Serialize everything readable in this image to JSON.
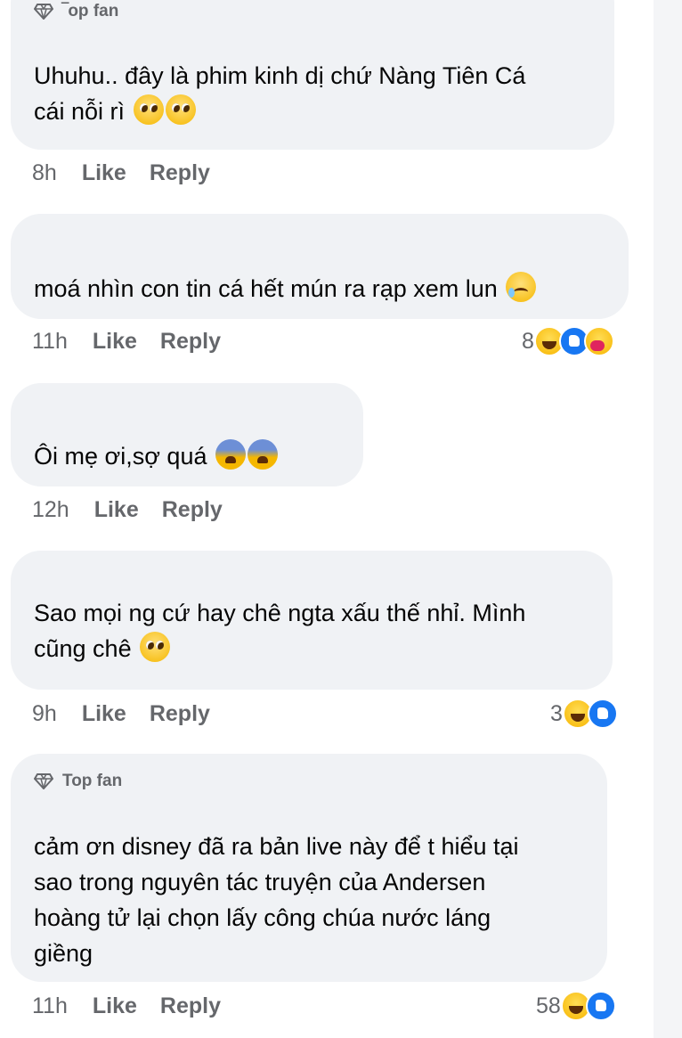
{
  "comments": [
    {
      "badge": "‾op fan",
      "text": "Uhuhu.. đây là phim kinh dị chứ Nàng Tiên Cá\ncái nỗi rì ",
      "emojis": [
        "pleading-face",
        "pleading-face"
      ],
      "time": "8h",
      "like": "Like",
      "reply": "Reply",
      "reaction_count": "",
      "reactions": []
    },
    {
      "badge": "",
      "text": "moá nhìn con tin cá hết mún ra rạp xem lun ",
      "emojis": [
        "crying-face"
      ],
      "time": "11h",
      "like": "Like",
      "reply": "Reply",
      "reaction_count": "8",
      "reactions": [
        "haha",
        "like",
        "care"
      ]
    },
    {
      "badge": "",
      "text": "Ôi mẹ ơi,sợ quá ",
      "emojis": [
        "fearful-face",
        "fearful-face"
      ],
      "time": "12h",
      "like": "Like",
      "reply": "Reply",
      "reaction_count": "",
      "reactions": []
    },
    {
      "badge": "",
      "text": "Sao mọi ng cứ hay chê ngta xấu thế nhỉ. Mình\ncũng chê ",
      "emojis": [
        "pleading-face"
      ],
      "time": "9h",
      "like": "Like",
      "reply": "Reply",
      "reaction_count": "3",
      "reactions": [
        "haha",
        "like"
      ]
    },
    {
      "badge": "Top fan",
      "text": "cảm ơn disney đã ra bản live này để t hiểu tại\nsao trong nguyên tác truyện của Andersen\nhoàng tử lại chọn lấy công chúa nước láng\ngiềng",
      "emojis": [],
      "time": "11h",
      "like": "Like",
      "reply": "Reply",
      "reaction_count": "58",
      "reactions": [
        "haha",
        "like"
      ]
    }
  ],
  "colors": {
    "bubble": "#f0f2f5",
    "meta": "#65676b",
    "like_blue": "#1877f2"
  }
}
